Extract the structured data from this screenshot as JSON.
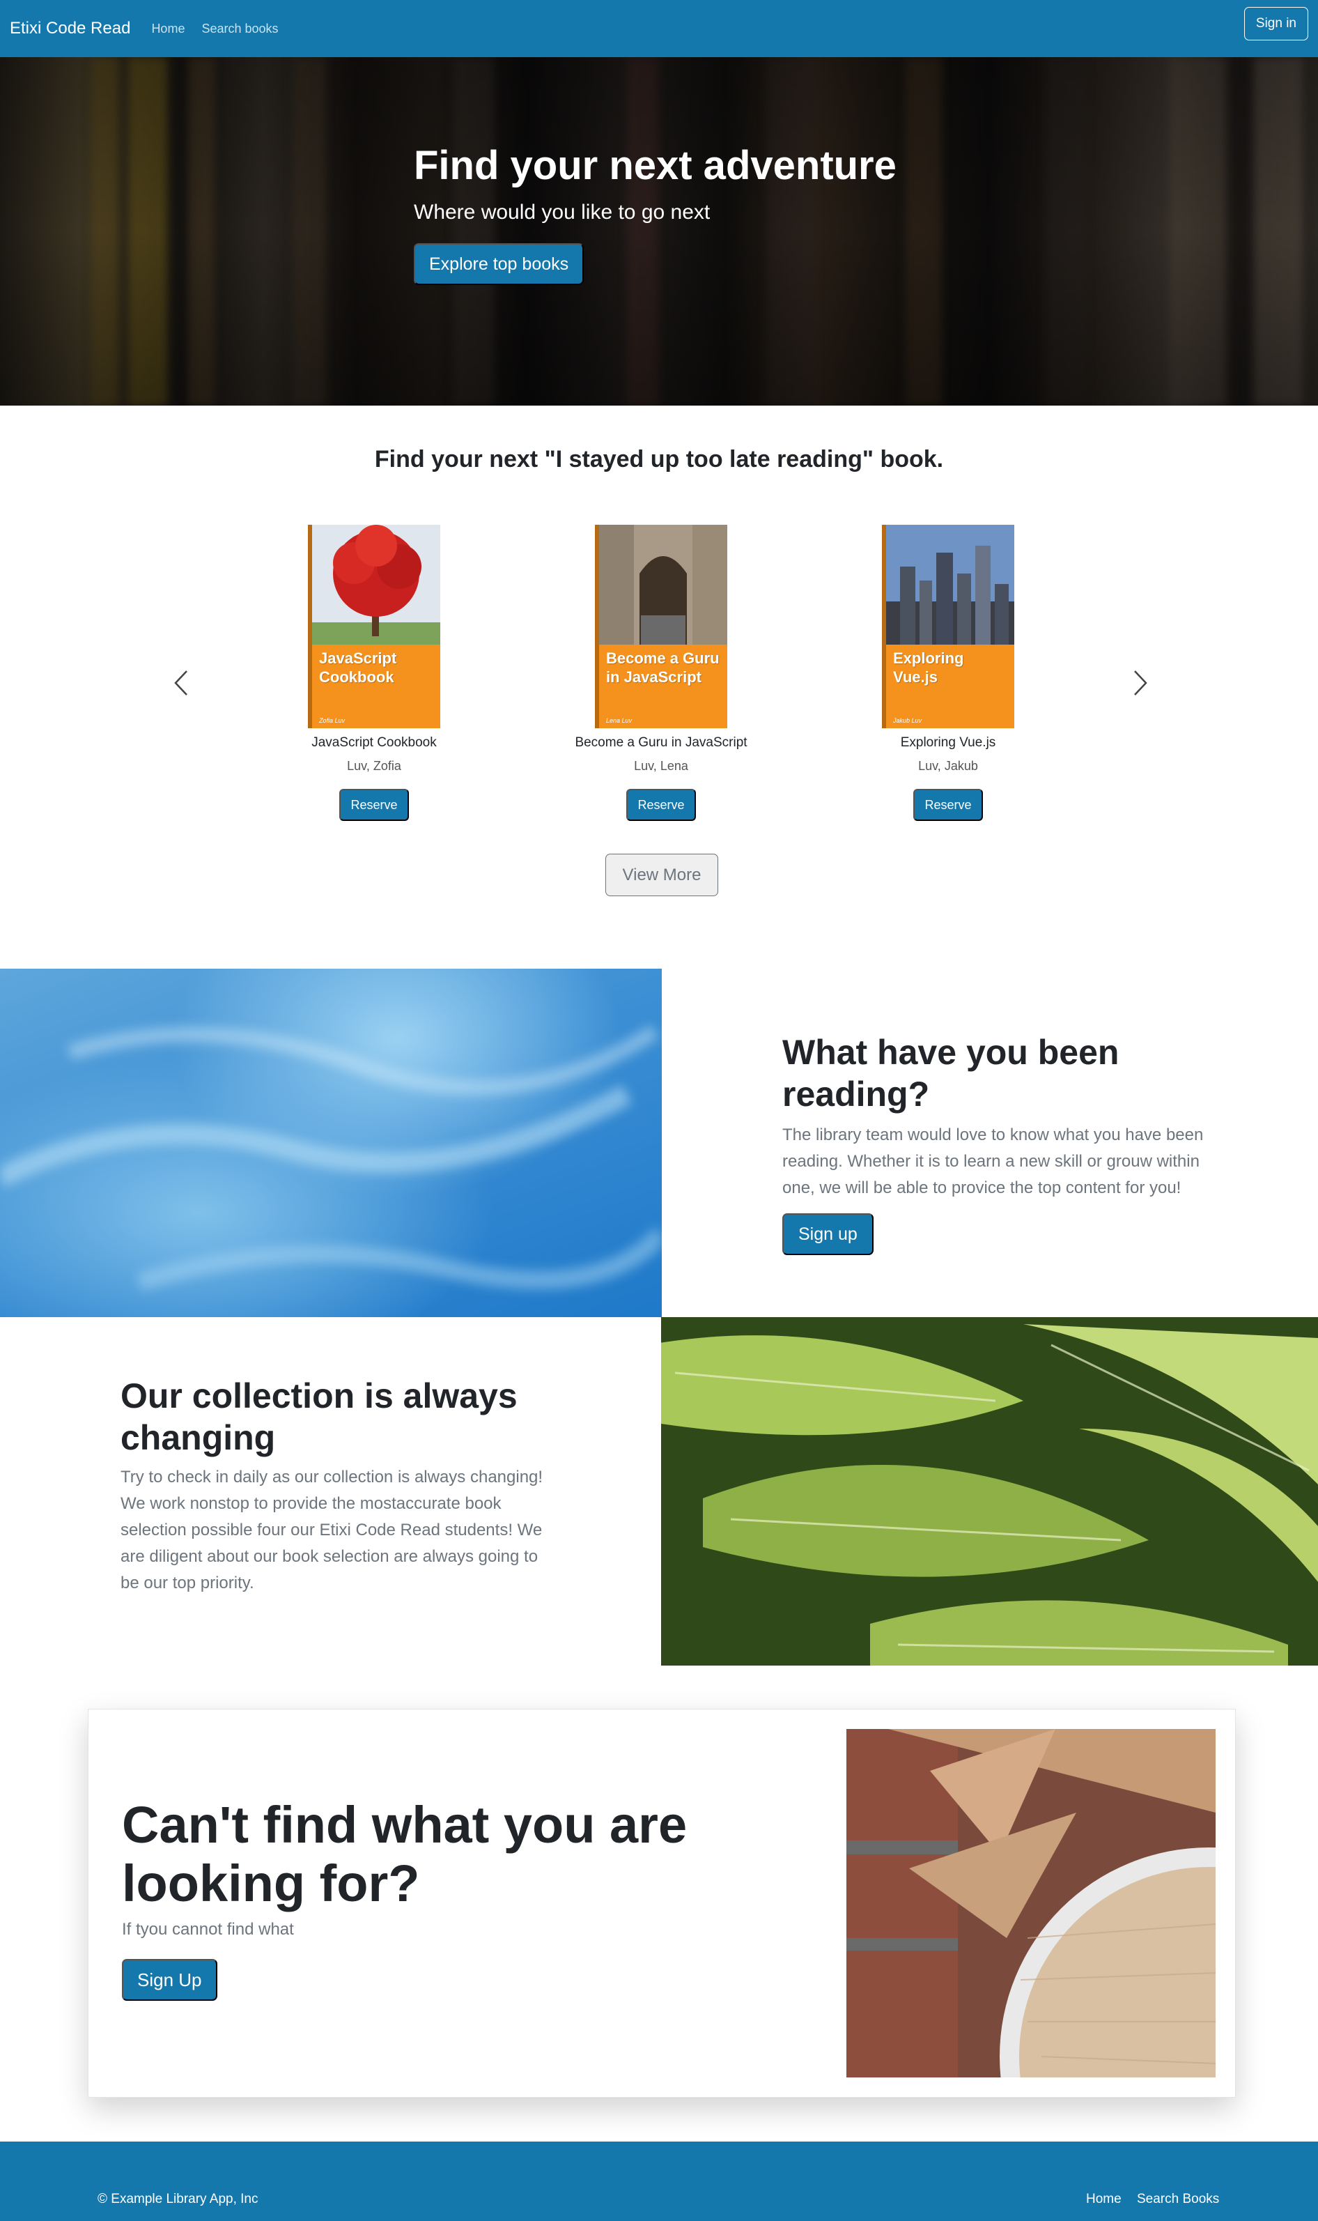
{
  "navbar": {
    "brand": "Etixi Code Read",
    "links": [
      "Home",
      "Search books"
    ],
    "signin_label": "Sign in"
  },
  "hero": {
    "title": "Find your next adventure",
    "subtitle": "Where would you like to go next",
    "button_label": "Explore top books"
  },
  "books_section": {
    "heading": "Find your next \"I stayed up too late reading\" book.",
    "books": [
      {
        "cover_title": "JavaScript Cookbook",
        "cover_author": "Zofia Luv",
        "title": "JavaScript Cookbook",
        "author": "Luv, Zofia",
        "button": "Reserve"
      },
      {
        "cover_title": "Become a Guru in JavaScript",
        "cover_author": "Lena Luv",
        "title": "Become a Guru in JavaScript",
        "author": "Luv, Lena",
        "button": "Reserve"
      },
      {
        "cover_title": "Exploring Vue.js",
        "cover_author": "Jakub Luv",
        "title": "Exploring Vue.js",
        "author": "Luv, Jakub",
        "button": "Reserve"
      }
    ],
    "view_more_label": "View More"
  },
  "reading_feature": {
    "title": "What have you been reading?",
    "text": "The library team would love to know what you have been reading. Whether it is to learn a new skill or grouw within one, we will be able to provice the top content for you!",
    "button_label": "Sign up"
  },
  "collection_feature": {
    "title": "Our collection is always changing",
    "text": "Try to check in daily as our collection is always changing! We work nonstop to provide the mostaccurate book selection possible four our Etixi Code Read students! We are diligent about our book selection are always going to be our top priority."
  },
  "cta_card": {
    "title": "Can't find what you are looking for?",
    "text": "If tyou cannot find what",
    "button_label": "Sign Up"
  },
  "footer": {
    "copyright": "© Example Library App, Inc",
    "links": [
      "Home",
      "Search Books"
    ]
  },
  "colors": {
    "primary": "#1478ad",
    "book_cover": "#f5921e",
    "text_dark": "#212529",
    "text_muted": "#6c757d"
  }
}
